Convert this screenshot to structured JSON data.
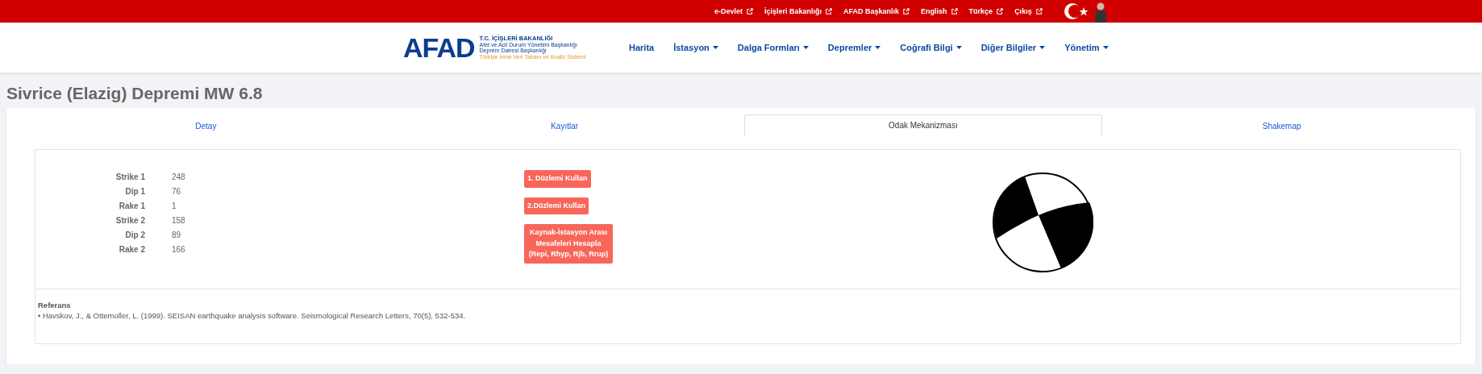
{
  "top_links": [
    "e-Devlet",
    "İçişleri Bakanlığı",
    "AFAD Başkanlık",
    "English",
    "Türkçe",
    "Çıkış"
  ],
  "logo": {
    "mark": "AFAD",
    "lines": [
      "T.C. İÇİŞLERİ BAKANLIĞI",
      "Afet ve Acil Durum Yönetimi Başkanlığı",
      "Deprem Dairesi Başkanlığı",
      "Türkiye İvme Veri Tabanı ve Analiz Sistemi"
    ]
  },
  "nav": [
    {
      "label": "Harita",
      "dropdown": false
    },
    {
      "label": "İstasyon",
      "dropdown": true
    },
    {
      "label": "Dalga Formları",
      "dropdown": true
    },
    {
      "label": "Depremler",
      "dropdown": true
    },
    {
      "label": "Coğrafi Bilgi",
      "dropdown": true
    },
    {
      "label": "Diğer Bilgiler",
      "dropdown": true
    },
    {
      "label": "Yönetim",
      "dropdown": true
    }
  ],
  "page_title": "Sivrice (Elazig) Depremi MW 6.8",
  "tabs": [
    {
      "label": "Detay",
      "selected": false
    },
    {
      "label": "Kayıtlar",
      "selected": false
    },
    {
      "label": "Odak Mekanizması",
      "selected": true
    },
    {
      "label": "Shakemap",
      "selected": false
    }
  ],
  "parameters": [
    {
      "label": "Strike 1",
      "value": "248"
    },
    {
      "label": "Dip 1",
      "value": "76"
    },
    {
      "label": "Rake 1",
      "value": "1"
    },
    {
      "label": "Strike 2",
      "value": "158"
    },
    {
      "label": "Dip 2",
      "value": "89"
    },
    {
      "label": "Rake 2",
      "value": "166"
    }
  ],
  "actions": [
    "1. Düzlemi Kullan",
    "2.Düzlemi Kullan",
    "Kaynak-İstasyon Arası Mesafeleri Hesapla (Repi, Rhyp, Rjb, Rrup)"
  ],
  "reference": {
    "title": "Referans",
    "items": [
      "• Havskov, J., & Ottemoller, L. (1999). SEISAN earthquake analysis software. Seismological Research Letters, 70(5), 532-534."
    ]
  }
}
